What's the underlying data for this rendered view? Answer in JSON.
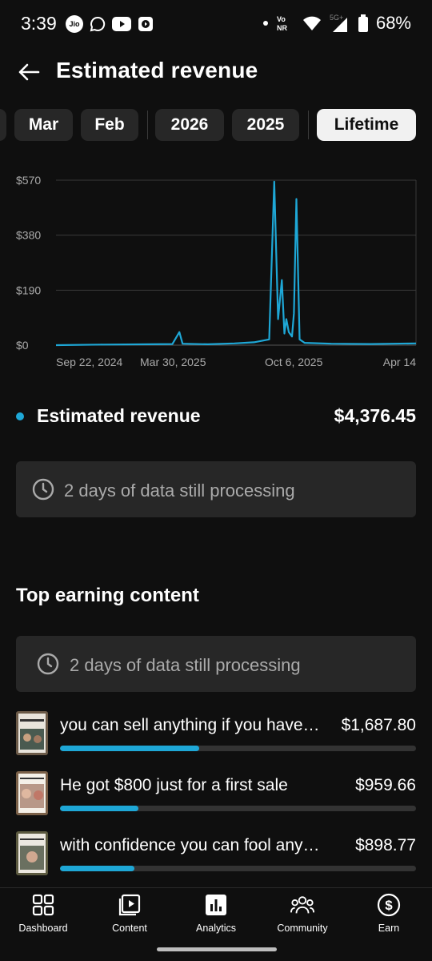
{
  "status_bar": {
    "time": "3:39",
    "carrier": "Jio",
    "network": "5G+",
    "volte": "Vo NR",
    "battery": "68%"
  },
  "header": {
    "title": "Estimated revenue",
    "back_icon": "arrow-left-icon"
  },
  "chips": [
    {
      "label": "Mar",
      "selected": false
    },
    {
      "label": "Feb",
      "selected": false
    },
    {
      "label": "2026",
      "selected": false
    },
    {
      "label": "2025",
      "selected": false
    },
    {
      "label": "Lifetime",
      "selected": true
    }
  ],
  "chart_data": {
    "type": "line",
    "x_ticks": [
      "Sep 22, 2024",
      "Mar 30, 2025",
      "Oct 6, 2025",
      "Apr 14"
    ],
    "y_ticks": [
      "$570",
      "$380",
      "$190",
      "$0"
    ],
    "ylim": [
      0,
      570
    ],
    "color": "#1ea7d6",
    "grid": true,
    "series": [
      {
        "points": [
          [
            "2024-09-22",
            0
          ],
          [
            "2024-12-01",
            2
          ],
          [
            "2025-02-15",
            3
          ],
          [
            "2025-03-25",
            4
          ],
          [
            "2025-04-05",
            45
          ],
          [
            "2025-04-10",
            5
          ],
          [
            "2025-05-20",
            3
          ],
          [
            "2025-07-01",
            6
          ],
          [
            "2025-08-01",
            10
          ],
          [
            "2025-08-25",
            20
          ],
          [
            "2025-09-02",
            565
          ],
          [
            "2025-09-08",
            90
          ],
          [
            "2025-09-14",
            225
          ],
          [
            "2025-09-18",
            40
          ],
          [
            "2025-09-21",
            90
          ],
          [
            "2025-09-25",
            45
          ],
          [
            "2025-09-30",
            30
          ],
          [
            "2025-10-03",
            110
          ],
          [
            "2025-10-07",
            505
          ],
          [
            "2025-10-12",
            20
          ],
          [
            "2025-10-20",
            8
          ],
          [
            "2025-12-01",
            5
          ],
          [
            "2026-02-01",
            4
          ],
          [
            "2026-04-14",
            6
          ]
        ]
      }
    ]
  },
  "metric": {
    "label": "Estimated revenue",
    "value": "$4,376.45"
  },
  "processing": {
    "text": "2 days of data still processing",
    "icon": "clock-icon"
  },
  "top_content": {
    "title": "Top earning content",
    "processing_text": "2 days of data still processing",
    "items": [
      {
        "title": "you can sell anything if you have confidence",
        "value": "$1,687.80",
        "share": 0.39
      },
      {
        "title": "He got $800 just for a first sale",
        "value": "$959.66",
        "share": 0.22
      },
      {
        "title": "with confidence you can fool anyone",
        "value": "$898.77",
        "share": 0.21
      }
    ]
  },
  "bottom_nav": [
    {
      "label": "Dashboard",
      "icon": "dashboard-icon"
    },
    {
      "label": "Content",
      "icon": "content-icon"
    },
    {
      "label": "Analytics",
      "icon": "analytics-icon"
    },
    {
      "label": "Community",
      "icon": "community-icon"
    },
    {
      "label": "Earn",
      "icon": "earn-icon"
    }
  ]
}
